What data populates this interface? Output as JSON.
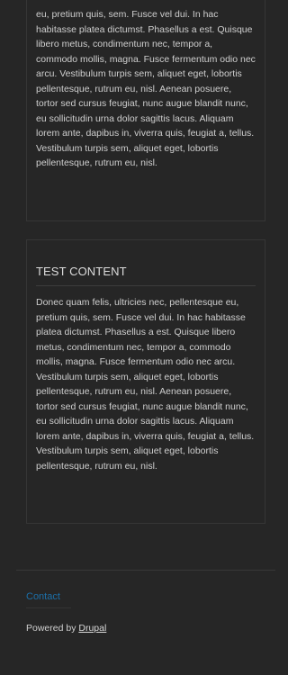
{
  "top_block": {
    "body": "eu, pretium quis, sem. Fusce vel dui. In hac habitasse platea dictumst. Phasellus a est. Quisque libero metus, condimentum nec, tempor a, commodo mollis, magna. Fusce fermentum odio nec arcu. Vestibulum turpis sem, aliquet eget, lobortis pellentesque, rutrum eu, nisl. Aenean posuere, tortor sed cursus feugiat, nunc augue blandit nunc, eu sollicitudin urna dolor sagittis lacus. Aliquam lorem ante, dapibus in, viverra quis, feugiat a, tellus. Vestibulum turpis sem, aliquet eget, lobortis pellentesque, rutrum eu, nisl."
  },
  "main_block": {
    "title": "TEST CONTENT",
    "body": "Donec quam felis, ultricies nec, pellentesque eu, pretium quis, sem. Fusce vel dui. In hac habitasse platea dictumst. Phasellus a est. Quisque libero metus, condimentum nec, tempor a, commodo mollis, magna. Fusce fermentum odio nec arcu. Vestibulum turpis sem, aliquet eget, lobortis pellentesque, rutrum eu, nisl. Aenean posuere, tortor sed cursus feugiat, nunc augue blandit nunc, eu sollicitudin urna dolor sagittis lacus. Aliquam lorem ante, dapibus in, viverra quis, feugiat a, tellus. Vestibulum turpis sem, aliquet eget, lobortis pellentesque, rutrum eu, nisl."
  },
  "footer": {
    "contact_label": "Contact",
    "powered_prefix": "Powered by",
    "powered_link": "Drupal"
  },
  "colors": {
    "background": "#262626",
    "link": "#1c6fa8",
    "text": "#cfcfcf"
  }
}
